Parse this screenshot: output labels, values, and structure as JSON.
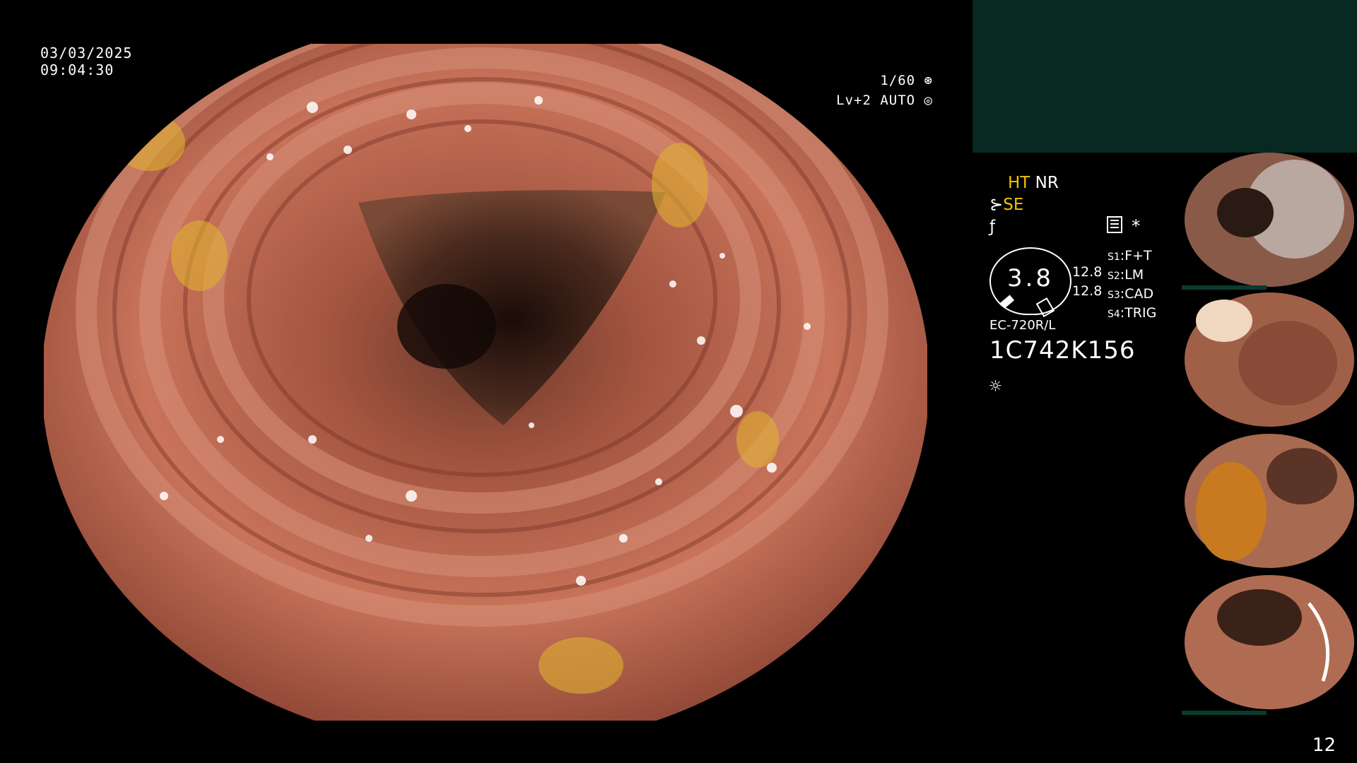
{
  "overlay": {
    "date": "03/03/2025",
    "time": "09:04:30",
    "shutter": "1/60",
    "level": "Lv+2 AUTO"
  },
  "panel": {
    "ht": "HT",
    "nr": "NR",
    "se": "SE",
    "dial_value": "3.8",
    "scale_1": "12.8",
    "scale_2": "12.8",
    "s_labels": [
      {
        "key": "S1",
        "value": "F+T"
      },
      {
        "key": "S2",
        "value": "LM"
      },
      {
        "key": "S3",
        "value": "CAD"
      },
      {
        "key": "S4",
        "value": "TRIG"
      }
    ],
    "asterisk": "*",
    "scope_model": "EC-720R/L",
    "serial": "1C742K156"
  },
  "icons": [
    "shutter-icon",
    "auto-iris-icon",
    "se-icon",
    "f-icon",
    "menu-icon",
    "light-icon"
  ],
  "thumbnails": [
    "capture-1",
    "capture-2",
    "capture-3",
    "capture-4"
  ],
  "page_number": "12",
  "colors": {
    "highlight": "#f2c200",
    "teal_panel": "#072921",
    "tissue": "#b8614a"
  }
}
